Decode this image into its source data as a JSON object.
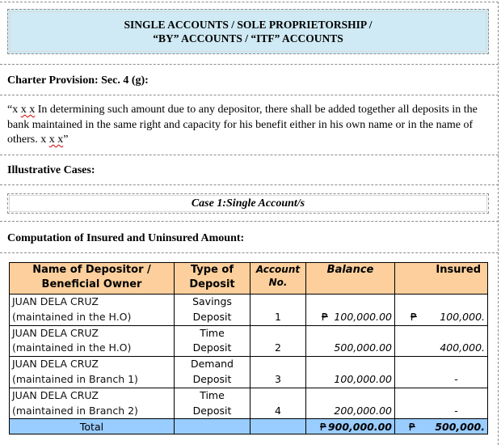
{
  "title": {
    "line1": "SINGLE ACCOUNTS / SOLE PROPRIETORSHIP /",
    "line2": "“BY” ACCOUNTS / “ITF” ACCOUNTS"
  },
  "charter": {
    "heading": "Charter Provision: Sec. 4 (g):",
    "quote_open": "“x ",
    "quote_xx1": "x x",
    "quote_body": " In determining such amount due to any depositor, there shall be added together all deposits in the bank maintained in the same right and capacity for his benefit either in his own name or in the name of others. x ",
    "quote_xx2": "x x",
    "quote_close": "”"
  },
  "illustrative": {
    "heading": "Illustrative Cases:"
  },
  "case": {
    "prefix": "Case 1:",
    "label": " Single Account/s"
  },
  "computation": {
    "heading": "Computation of Insured and Uninsured Amount:",
    "currency_symbol": "₱",
    "headers": {
      "name": "Name of Depositor / Beneficial Owner",
      "type": "Type of Deposit",
      "account": "Account No.",
      "balance": "Balance",
      "insured": "Insured"
    },
    "rows": [
      {
        "name1": "JUAN DELA CRUZ",
        "name2": "(maintained in the H.O)",
        "type1": "Savings",
        "type2": "Deposit",
        "account": "1",
        "balance": "100,000.00",
        "insured": "100,000."
      },
      {
        "name1": "JUAN DELA CRUZ",
        "name2": "(maintained in the H.O)",
        "type1": "Time",
        "type2": "Deposit",
        "account": "2",
        "balance": "500,000.00",
        "insured": "400,000."
      },
      {
        "name1": "JUAN DELA CRUZ",
        "name2": "(maintained in Branch 1)",
        "type1": "Demand",
        "type2": "Deposit",
        "account": "3",
        "balance": "100,000.00",
        "insured": "-"
      },
      {
        "name1": "JUAN DELA CRUZ",
        "name2": "(maintained in Branch 2)",
        "type1": "Time",
        "type2": "Deposit",
        "account": "4",
        "balance": "200,000.00",
        "insured": "-"
      }
    ],
    "total": {
      "label": "Total",
      "balance": "900,000.00",
      "insured": "500,000."
    },
    "colors": {
      "header_bg": "#fccf9c",
      "total_bg": "#99ccff",
      "title_bg": "#cfeaf4"
    }
  }
}
